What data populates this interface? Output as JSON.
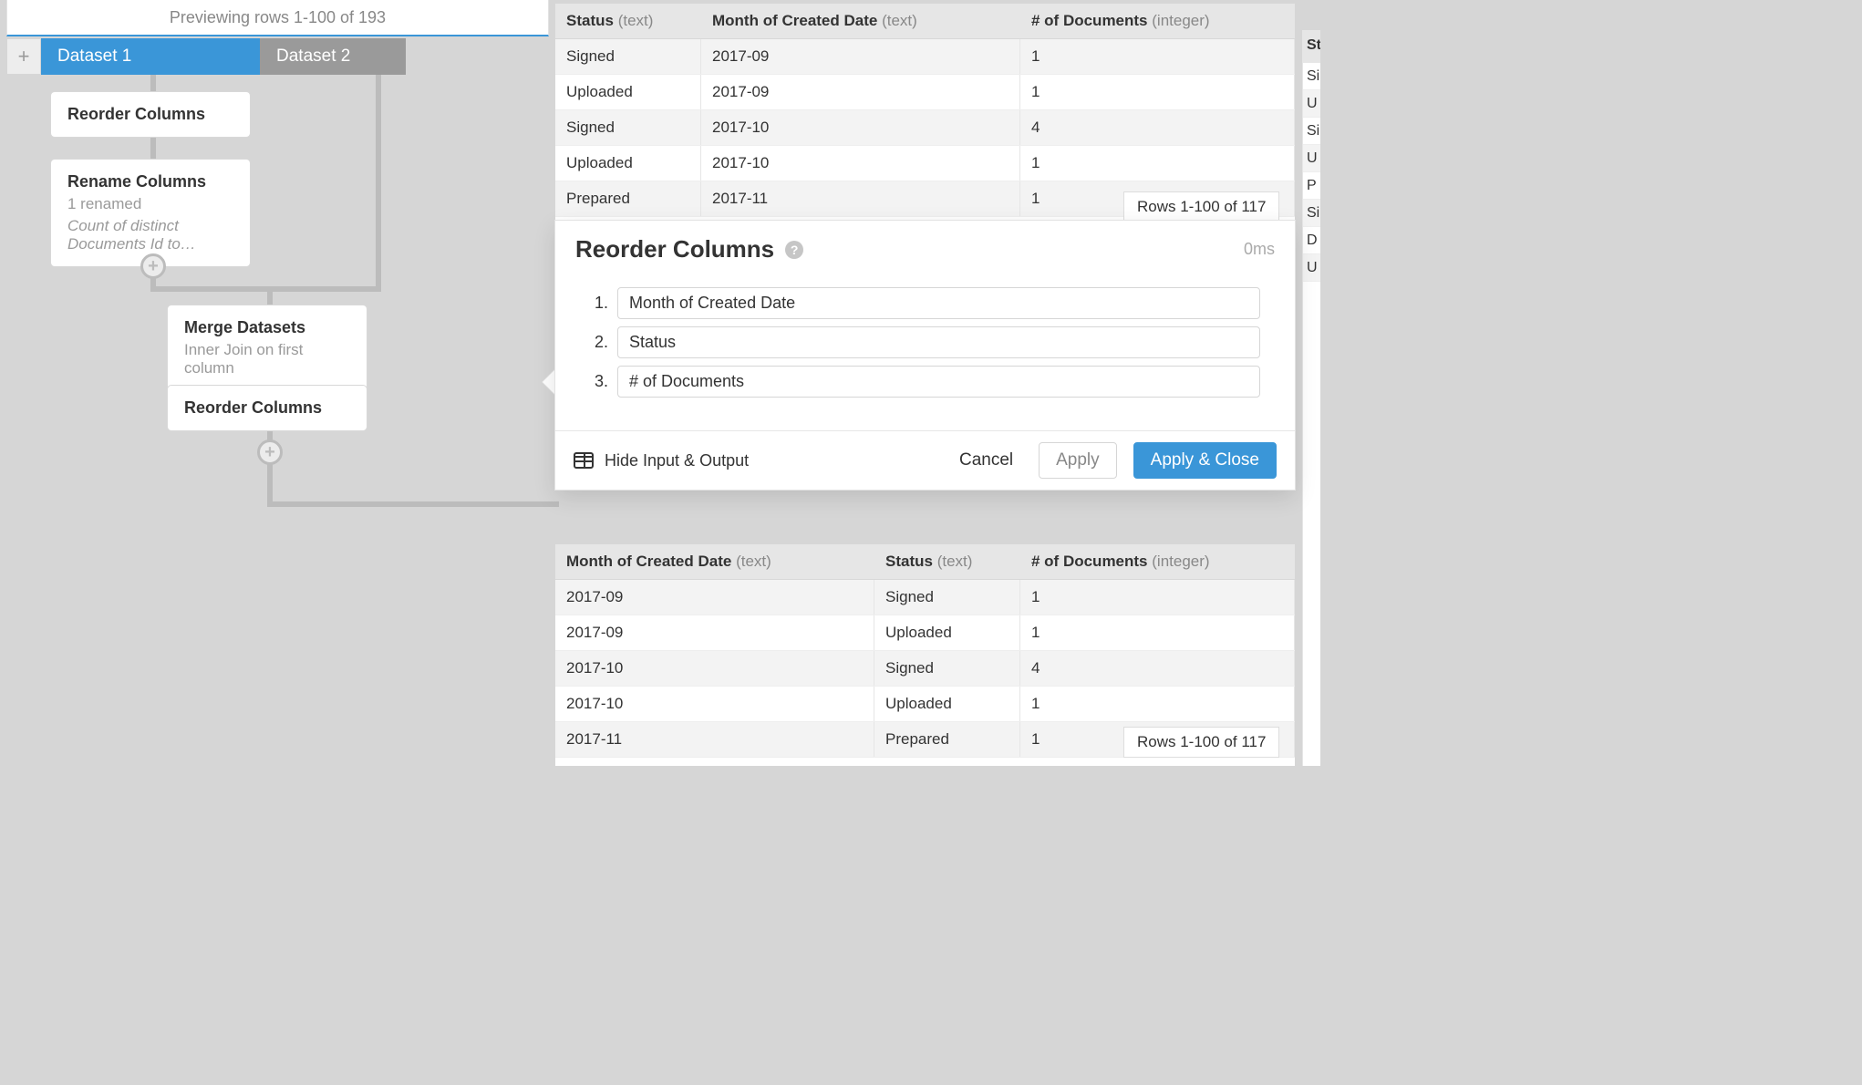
{
  "preview_text": "Previewing rows 1-100 of 193",
  "tabs": {
    "add_label": "+",
    "dataset1": "Dataset 1",
    "dataset2": "Dataset 2"
  },
  "flow": {
    "reorder1": "Reorder Columns",
    "rename_title": "Rename Columns",
    "rename_sub1": "1 renamed",
    "rename_sub2": "Count of distinct Documents Id to…",
    "merge_title": "Merge Datasets",
    "merge_sub": "Inner Join on first column",
    "reorder2": "Reorder Columns"
  },
  "input_table": {
    "cols": [
      {
        "name": "Status",
        "type": "(text)"
      },
      {
        "name": "Month of Created Date",
        "type": "(text)"
      },
      {
        "name": "# of Documents",
        "type": "(integer)"
      }
    ],
    "rows": [
      [
        "Signed",
        "2017-09",
        "1"
      ],
      [
        "Uploaded",
        "2017-09",
        "1"
      ],
      [
        "Signed",
        "2017-10",
        "4"
      ],
      [
        "Uploaded",
        "2017-10",
        "1"
      ],
      [
        "Prepared",
        "2017-11",
        "1"
      ]
    ],
    "badge": "Rows 1-100 of 117"
  },
  "dialog": {
    "title": "Reorder Columns",
    "timing": "0ms",
    "items": [
      "Month of Created Date",
      "Status",
      "# of Documents"
    ],
    "hide_label": "Hide Input & Output",
    "cancel": "Cancel",
    "apply": "Apply",
    "apply_close": "Apply & Close"
  },
  "output_table": {
    "cols": [
      {
        "name": "Month of Created Date",
        "type": "(text)"
      },
      {
        "name": "Status",
        "type": "(text)"
      },
      {
        "name": "# of Documents",
        "type": "(integer)"
      }
    ],
    "rows": [
      [
        "2017-09",
        "Signed",
        "1"
      ],
      [
        "2017-09",
        "Uploaded",
        "1"
      ],
      [
        "2017-10",
        "Signed",
        "4"
      ],
      [
        "2017-10",
        "Uploaded",
        "1"
      ],
      [
        "2017-11",
        "Prepared",
        "1"
      ]
    ],
    "badge": "Rows 1-100 of 117"
  },
  "peek": {
    "header": "St",
    "rows": [
      "Si",
      "U",
      "Si",
      "U",
      "P",
      "Si",
      "D",
      "U"
    ]
  }
}
